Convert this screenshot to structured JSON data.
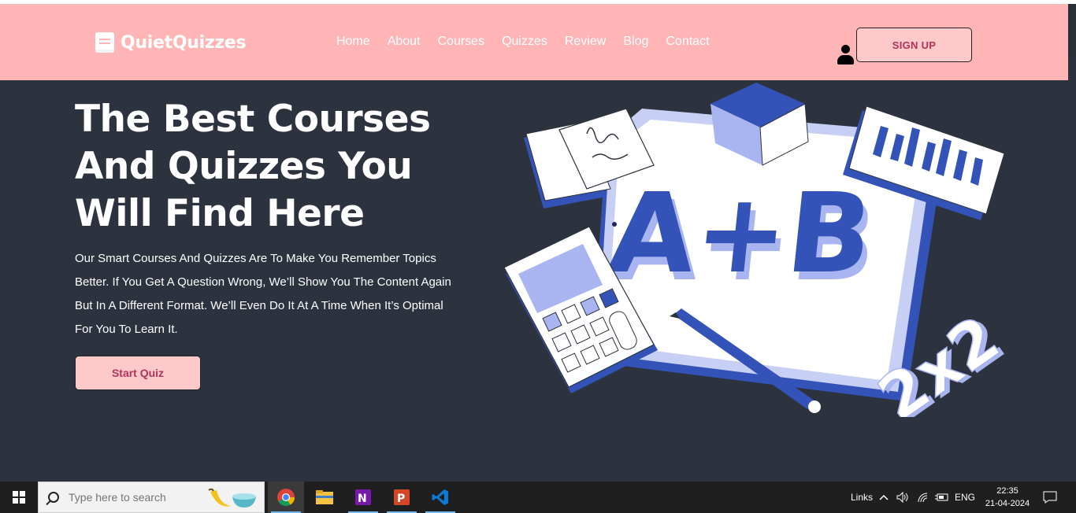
{
  "brand": {
    "name": "QuietQuizzes",
    "icon": "book-icon"
  },
  "nav": {
    "items": [
      "Home",
      "About",
      "Courses",
      "Quizzes",
      "Review",
      "Blog",
      "Contact"
    ]
  },
  "header": {
    "signup_label": "SIGN UP",
    "user_icon": "user-icon"
  },
  "hero": {
    "title_lines": [
      "The Best Courses",
      "And Quizzes You",
      "Will Find Here"
    ],
    "description_lines": [
      "Our Smart Courses And Quizzes Are To Make You Remember Topics",
      "Better. If You Get A Question Wrong, We’ll Show You The Content Again",
      "But In A Different Format. We’ll Even Do It At A Time When It’s Optimal",
      "For You To Learn It."
    ],
    "cta_label": "Start Quiz",
    "illustration": {
      "main_text": "A+B",
      "side_text": "2x2"
    }
  },
  "taskbar": {
    "search_placeholder": "Type here to search",
    "apps": [
      "chrome-icon",
      "file-explorer-icon",
      "onenote-icon",
      "powerpoint-icon",
      "vscode-icon"
    ],
    "tray": {
      "links_label": "Links",
      "language": "ENG",
      "time": "22:35",
      "date": "21-04-2024"
    }
  },
  "colors": {
    "header_bg": "#ffb5b5",
    "hero_bg": "#2d333e",
    "button_bg": "#ffc9c9",
    "button_text": "#b0335b",
    "accent_blue": "#3453b8"
  }
}
